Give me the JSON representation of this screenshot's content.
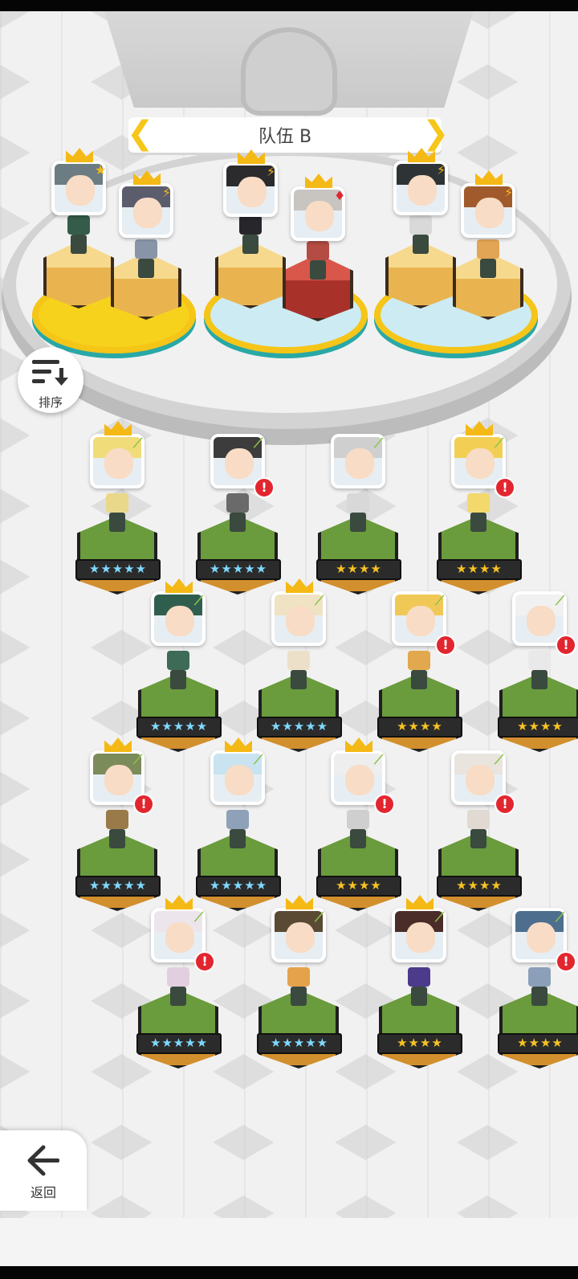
{
  "team": {
    "title": "队伍 B"
  },
  "sort_button": {
    "label": "排序",
    "icon": "sort-icon"
  },
  "back_button": {
    "label": "返回",
    "icon": "arrow-left-icon"
  },
  "colors": {
    "crown": "#f5b915",
    "alert": "#e2262f",
    "grass": "#6a9b3c",
    "star_gold": "#f7c223",
    "star_rainbow": "#7fd8ff",
    "banner_chevron": "#f6c71a"
  },
  "team_slots": [
    {
      "hair": "#6b7d83",
      "sprite": "#355c4a",
      "badge": "★",
      "crowned": true
    },
    {
      "hair": "#5b5d6d",
      "sprite": "#8895a8",
      "badge": "⚡",
      "crowned": true
    },
    {
      "hair": "#2b2b2e",
      "sprite": "#27272b",
      "badge": "⚡",
      "crowned": true
    },
    {
      "hair": "#c8c4c0",
      "sprite": "#b44c44",
      "badge": "♦",
      "crowned": true
    },
    {
      "hair": "#2e3436",
      "sprite": "#d9d9d9",
      "badge": "⚡",
      "crowned": true
    },
    {
      "hair": "#a05a2c",
      "sprite": "#e2a455",
      "badge": "⚡",
      "crowned": true
    }
  ],
  "roster": [
    {
      "stars": "★★★★★",
      "rainbow": true,
      "crowned": true,
      "alert": false,
      "hair": "#f1dc7a",
      "sprite": "#e9d88a"
    },
    {
      "stars": "★★★★★",
      "rainbow": true,
      "crowned": false,
      "alert": true,
      "hair": "#3c3c3c",
      "sprite": "#6a6a6a"
    },
    {
      "stars": "★★★★",
      "rainbow": false,
      "crowned": false,
      "alert": false,
      "hair": "#cfcfcf",
      "sprite": "#d8d8d8"
    },
    {
      "stars": "★★★★",
      "rainbow": false,
      "crowned": true,
      "alert": true,
      "hair": "#f2cf54",
      "sprite": "#f3d86b"
    },
    {
      "stars": "★★★★★",
      "rainbow": true,
      "crowned": true,
      "alert": false,
      "hair": "#2f5e4f",
      "sprite": "#3d6b58"
    },
    {
      "stars": "★★★★★",
      "rainbow": true,
      "crowned": true,
      "alert": false,
      "hair": "#efe3c3",
      "sprite": "#ece0c8"
    },
    {
      "stars": "★★★★",
      "rainbow": false,
      "crowned": false,
      "alert": true,
      "hair": "#f0c856",
      "sprite": "#e2a84d"
    },
    {
      "stars": "★★★★",
      "rainbow": false,
      "crowned": false,
      "alert": true,
      "hair": "#f1f1f1",
      "sprite": "#e9e9e9"
    },
    {
      "stars": "★★★★★",
      "rainbow": true,
      "crowned": true,
      "alert": true,
      "hair": "#7c8b5a",
      "sprite": "#9b7a4a"
    },
    {
      "stars": "★★★★★",
      "rainbow": true,
      "crowned": true,
      "alert": false,
      "hair": "#c9e3f0",
      "sprite": "#8ea1b8"
    },
    {
      "stars": "★★★★",
      "rainbow": false,
      "crowned": true,
      "alert": true,
      "hair": "#eeeeee",
      "sprite": "#cfcfcf"
    },
    {
      "stars": "★★★★",
      "rainbow": false,
      "crowned": false,
      "alert": true,
      "hair": "#e9e4de",
      "sprite": "#e0dad3"
    },
    {
      "stars": "★★★★★",
      "rainbow": true,
      "crowned": true,
      "alert": true,
      "hair": "#ece6ec",
      "sprite": "#e1cfe0"
    },
    {
      "stars": "★★★★★",
      "rainbow": true,
      "crowned": true,
      "alert": false,
      "hair": "#5a4a33",
      "sprite": "#e6a24b"
    },
    {
      "stars": "★★★★",
      "rainbow": false,
      "crowned": true,
      "alert": false,
      "hair": "#4a2d28",
      "sprite": "#4b3b8a"
    },
    {
      "stars": "★★★★",
      "rainbow": false,
      "crowned": false,
      "alert": true,
      "hair": "#4e6e8e",
      "sprite": "#8c9fb9"
    }
  ]
}
